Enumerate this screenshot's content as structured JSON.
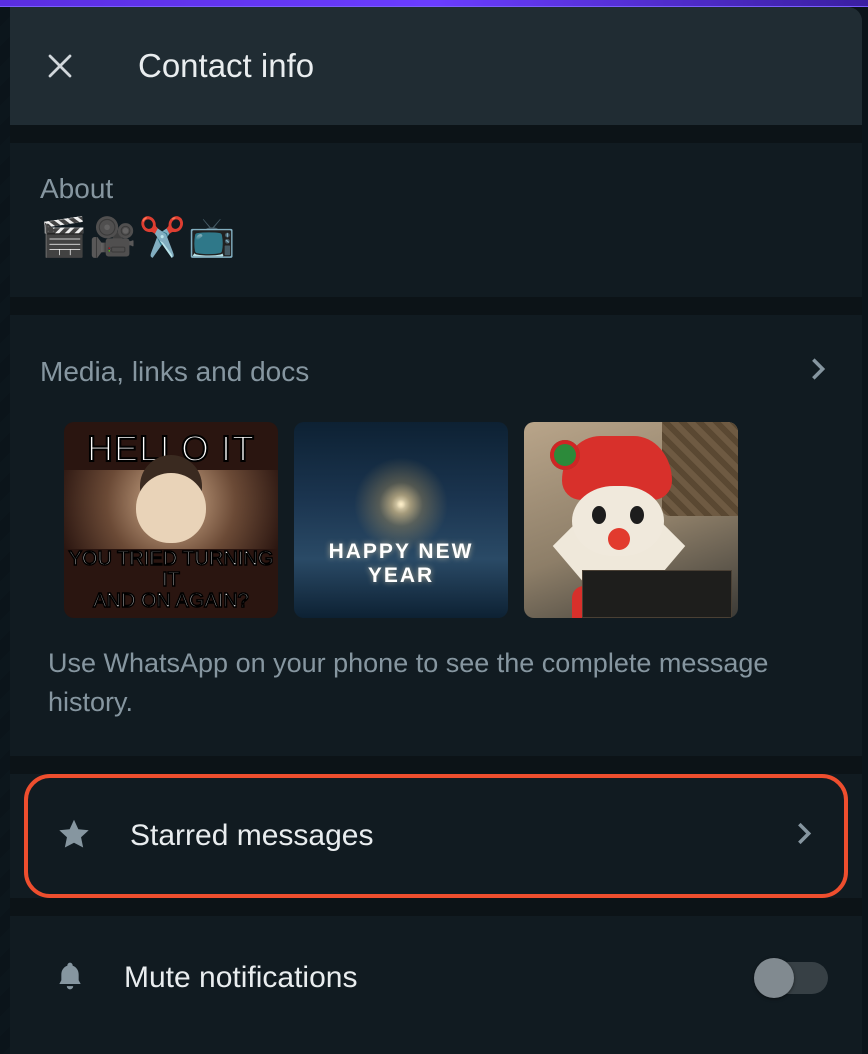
{
  "header": {
    "title": "Contact info"
  },
  "about": {
    "label": "About",
    "value": "🎬🎥✂️📺"
  },
  "media": {
    "label": "Media, links and docs",
    "hint": "Use WhatsApp on your phone to see the complete message history.",
    "thumbs": {
      "t1": {
        "top": "HELLO IT",
        "bottom1": "YOU TRIED TURNING IT",
        "bottom2": "AND ON AGAIN?"
      },
      "t2": {
        "caption": "HAPPY NEW YEAR"
      },
      "t3": {
        "alt": "Santa decoration"
      }
    }
  },
  "starred": {
    "label": "Starred messages"
  },
  "mute": {
    "label": "Mute notifications",
    "enabled": false
  }
}
